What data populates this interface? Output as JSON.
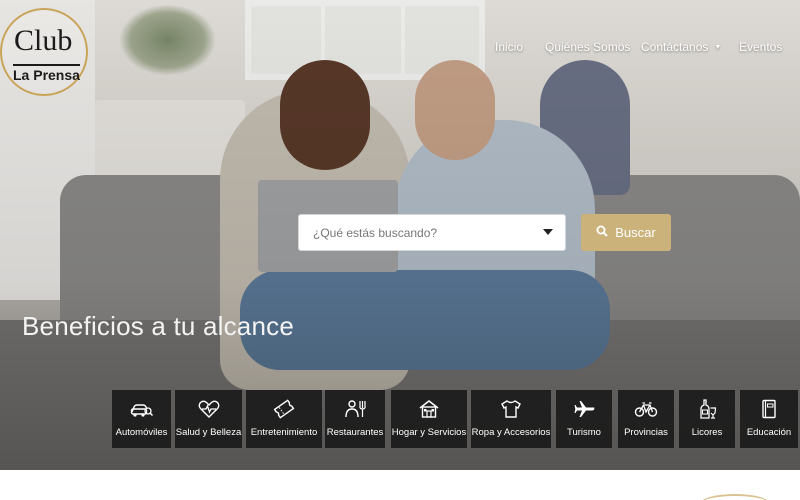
{
  "logo": {
    "club": "Club",
    "prensa": "La Prensa"
  },
  "nav": {
    "items": [
      {
        "label": "Inicio"
      },
      {
        "label": "Quiénes Somos"
      },
      {
        "label": "Contáctanos",
        "has_dropdown": true
      },
      {
        "label": "Eventos"
      }
    ]
  },
  "search": {
    "placeholder": "¿Qué estás buscando?",
    "button_label": "Buscar"
  },
  "hero": {
    "tagline": "Beneficios a tu alcance"
  },
  "categories": [
    {
      "label": "Automóviles",
      "icon": "car-search-icon"
    },
    {
      "label": "Salud y Belleza",
      "icon": "heart-pulse-icon"
    },
    {
      "label": "Entretenimiento",
      "icon": "ticket-icon"
    },
    {
      "label": "Restaurantes",
      "icon": "chef-icon"
    },
    {
      "label": "Hogar y Servicios",
      "icon": "house-icon"
    },
    {
      "label": "Ropa y Accesorios",
      "icon": "tshirt-icon"
    },
    {
      "label": "Turismo",
      "icon": "airplane-icon"
    },
    {
      "label": "Provincias",
      "icon": "bicycle-icon"
    },
    {
      "label": "Licores",
      "icon": "bottles-icon"
    },
    {
      "label": "Educación",
      "icon": "book-icon"
    }
  ],
  "colors": {
    "accent_gold": "#cbb27a",
    "tile_bg": "#161616"
  }
}
